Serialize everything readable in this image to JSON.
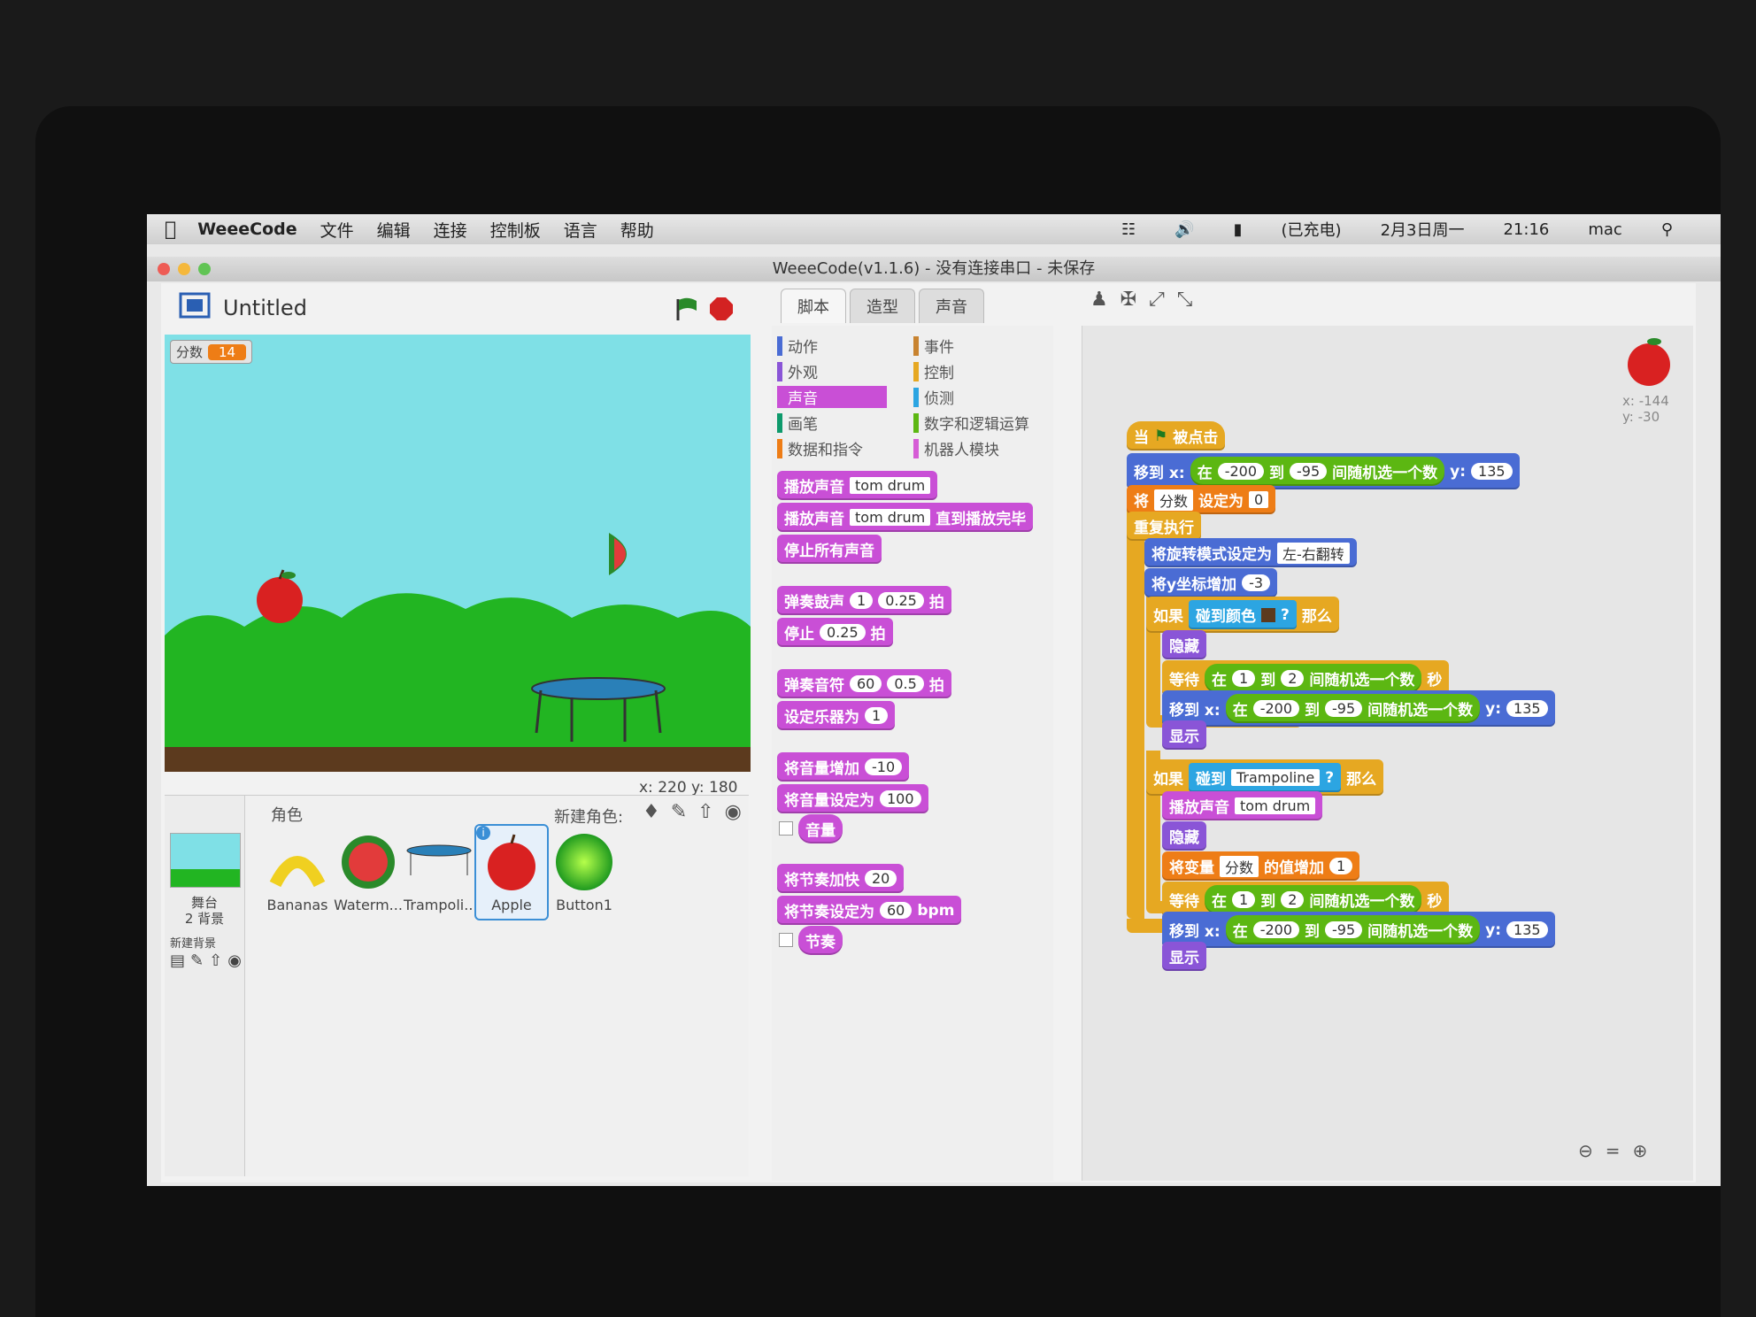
{
  "menubar": {
    "app": "WeeeCode",
    "items": [
      "文件",
      "编辑",
      "连接",
      "控制板",
      "语言",
      "帮助"
    ],
    "status": "(已充电)",
    "date": "2月3日周一",
    "time": "21:16",
    "user": "mac"
  },
  "window_title": "WeeeCode(v1.1.6) - 没有连接串口 - 未保存",
  "project_title": "Untitled",
  "stage": {
    "score_label": "分数",
    "score_value": "14",
    "coord_x": "x: 220",
    "coord_y": "y: 180"
  },
  "sprites_pane": {
    "header": "角色",
    "new_sprite_label": "新建角色:",
    "stage_label": "舞台",
    "backdrops": "2 背景",
    "new_backdrop_label": "新建背景",
    "sprites": [
      "Bananas",
      "Waterm...",
      "Trampoli...",
      "Apple",
      "Button1"
    ]
  },
  "tabs": [
    "脚本",
    "造型",
    "声音"
  ],
  "categories": {
    "left": [
      "动作",
      "外观",
      "声音",
      "画笔",
      "数据和指令"
    ],
    "right": [
      "事件",
      "控制",
      "侦测",
      "数字和逻辑运算",
      "机器人模块"
    ]
  },
  "palette": {
    "play_sound": "播放声音",
    "sound_name": "tom drum",
    "until_done": "直到播放完毕",
    "stop_all": "停止所有声音",
    "play_drum": "弹奏鼓声",
    "drum_num": "1",
    "beats_025": "0.25",
    "beat": "拍",
    "rest": "停止",
    "play_note": "弹奏音符",
    "note_num": "60",
    "note_beats": "0.5",
    "set_instrument": "设定乐器为",
    "instrument_num": "1",
    "change_volume": "将音量增加",
    "volume_delta": "-10",
    "set_volume": "将音量设定为",
    "volume_value": "100",
    "volume": "音量",
    "change_tempo": "将节奏加快",
    "tempo_delta": "20",
    "set_tempo": "将节奏设定为",
    "tempo_value": "60",
    "bpm": "bpm",
    "tempo": "节奏"
  },
  "script": {
    "when": "当",
    "clicked": "被点击",
    "goto": "移到 x:",
    "at": "在",
    "to": "到",
    "random": "间随机选一个数",
    "y_label": "y:",
    "x_min": "-200",
    "x_max": "-95",
    "y_val": "135",
    "set_var": "将",
    "var_name": "分数",
    "set_to": "设定为",
    "zero": "0",
    "forever": "重复执行",
    "rotation": "将旋转模式设定为",
    "rotation_mode": "左-右翻转",
    "change_y": "将y坐标增加",
    "dy": "-3",
    "if": "如果",
    "touch_color": "碰到颜色",
    "q": "?",
    "then": "那么",
    "hide": "隐藏",
    "wait": "等待",
    "one": "1",
    "two": "2",
    "sec": "秒",
    "show": "显示",
    "touching": "碰到",
    "target": "Trampoline",
    "change_var": "将变量",
    "change_by": "的值增加",
    "sprite_x": "x: -144",
    "sprite_y": "y: -30"
  },
  "colors": {
    "sound": "#c94fd6",
    "motion": "#4a6cd4",
    "control": "#e6a822",
    "sky": "#7fe0e6",
    "grass": "#22b522"
  }
}
